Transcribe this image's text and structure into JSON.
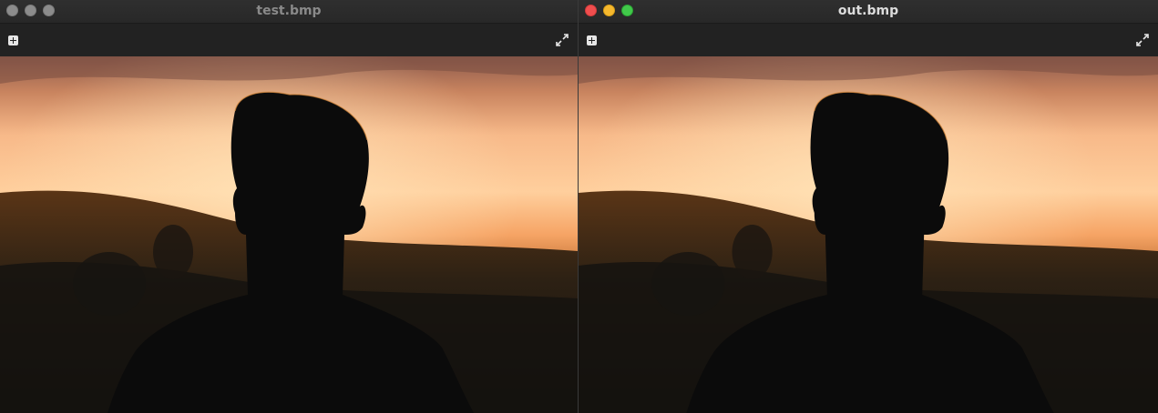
{
  "windows": [
    {
      "title": "test.bmp",
      "state": "inactive",
      "toolbar": {
        "add_icon": "add-square-icon",
        "fullscreen_icon": "expand-icon"
      }
    },
    {
      "title": "out.bmp",
      "state": "active",
      "toolbar": {
        "add_icon": "add-square-icon",
        "fullscreen_icon": "expand-icon"
      }
    }
  ],
  "colors": {
    "close": "#f04e4e",
    "minimize": "#f5b82e",
    "maximize": "#41c94a",
    "inactive_dot": "#8c8c8c",
    "sky_top": "#a56a52",
    "sky_glow": "#ffd09a",
    "sunset_orange": "#f39a3c",
    "silhouette": "#0b0b0b"
  }
}
